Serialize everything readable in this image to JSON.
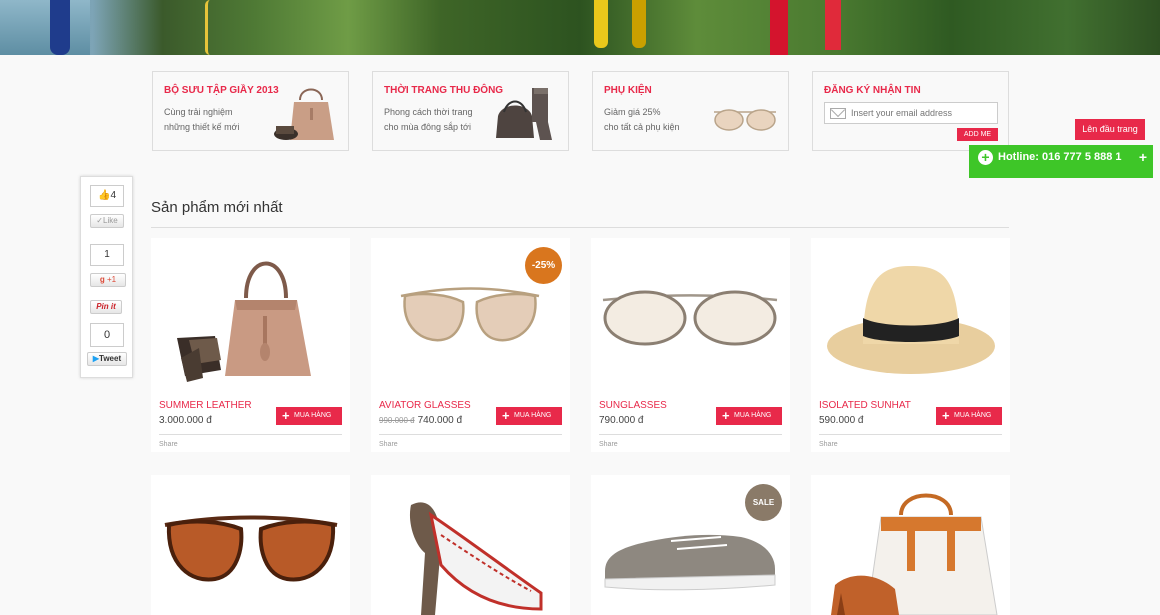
{
  "promos": [
    {
      "title": "BỘ SƯU TẬP GIẦY 2013",
      "desc1": "Cùng trải nghiệm",
      "desc2": "những thiết kế mới"
    },
    {
      "title": "THỜI TRANG THU ĐÔNG",
      "desc1": "Phong cách thời trang",
      "desc2": "cho mùa đông sắp tới"
    },
    {
      "title": "PHỤ KIỆN",
      "desc1": "Giảm giá 25%",
      "desc2": "cho tất cả phụ kiện"
    }
  ],
  "newsletter": {
    "title": "ĐĂNG KÝ NHẬN TIN",
    "placeholder": "Insert your email address",
    "button": "ADD ME"
  },
  "social": {
    "like_count": "4",
    "like_label": "Like",
    "gplus_count": "1",
    "gplus_label": "+1",
    "pin_label": "Pin it",
    "tweet_count": "0",
    "tweet_label": "Tweet"
  },
  "float": {
    "to_top": "Lên đầu trang",
    "hotline": "Hotline: 016 777 5 888 1",
    "hotline_plus": "+"
  },
  "section": {
    "title": "Sản phẩm mới nhất"
  },
  "products": [
    {
      "name": "SUMMER LEATHER",
      "price": "3.000.000 đ",
      "old_price": "",
      "buy": "MUA HÀNG",
      "share": "Share"
    },
    {
      "name": "AVIATOR GLASSES",
      "price": "740.000 đ",
      "old_price": "990.000 đ",
      "buy": "MUA HÀNG",
      "share": "Share",
      "badge": "-25%"
    },
    {
      "name": "SUNGLASSES",
      "price": "790.000 đ",
      "old_price": "",
      "buy": "MUA HÀNG",
      "share": "Share"
    },
    {
      "name": "ISOLATED SUNHAT",
      "price": "590.000 đ",
      "old_price": "",
      "buy": "MUA HÀNG",
      "share": "Share"
    }
  ],
  "products_row2": [
    {
      "badge": ""
    },
    {
      "badge": ""
    },
    {
      "badge": "SALE"
    },
    {
      "badge": ""
    }
  ],
  "colors": {
    "accent": "#e8294a",
    "hotline": "#3ec628",
    "badge_discount": "#d9761e",
    "badge_sale": "#8a7a68"
  }
}
